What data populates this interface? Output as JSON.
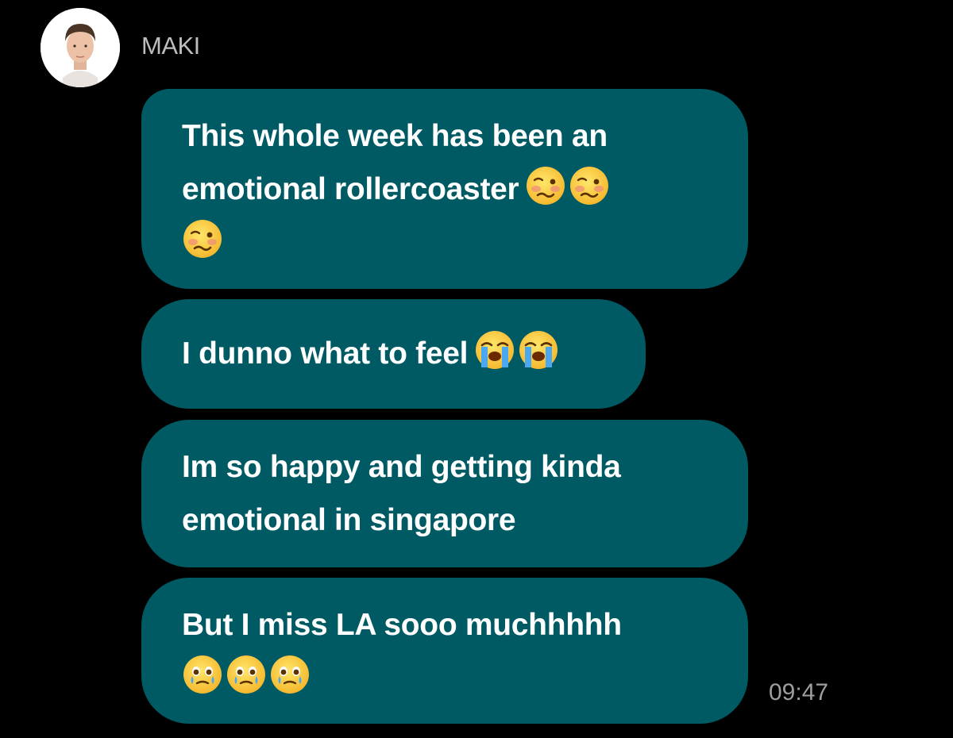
{
  "sender": {
    "name": "MAKI",
    "avatar": "profile-photo"
  },
  "messages": [
    {
      "lines": [
        "This whole week has been an",
        "emotional rollercoaster",
        ""
      ],
      "emojis": [
        "woozy-face",
        "woozy-face",
        "woozy-face"
      ]
    },
    {
      "lines": [
        "I dunno what to feel"
      ],
      "emojis": [
        "loudly-crying-face",
        "loudly-crying-face"
      ]
    },
    {
      "lines": [
        "Im so happy and getting kinda",
        "emotional in singapore"
      ],
      "emojis": []
    },
    {
      "lines": [
        "But I miss LA sooo muchhhhh"
      ],
      "emojis": [
        "face-holding-back-tears",
        "face-holding-back-tears",
        "face-holding-back-tears"
      ]
    }
  ],
  "timestamp": "09:47",
  "colors": {
    "background": "#000000",
    "bubble": "#005a63",
    "text": "#ffffff",
    "meta_text": "#9e9e9e"
  }
}
